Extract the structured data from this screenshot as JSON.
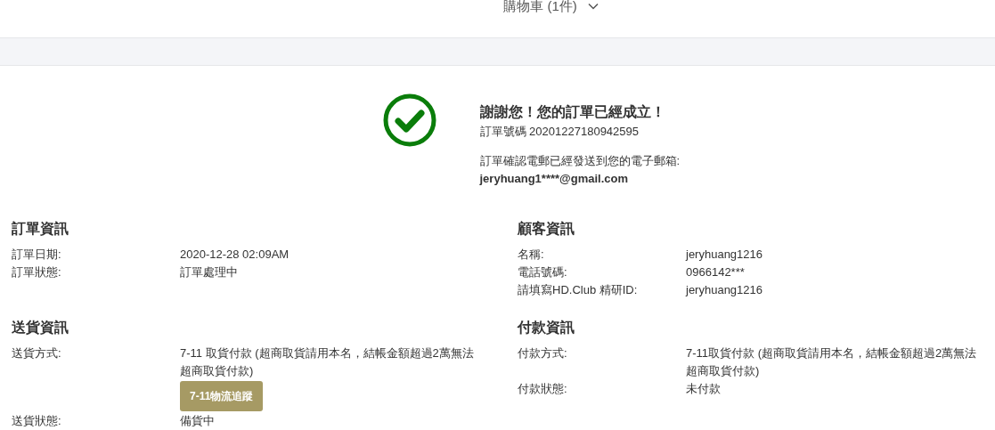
{
  "header": {
    "cart_label": "購物車 (1件)",
    "cart_expanded": false
  },
  "confirmation": {
    "title": "謝謝您！您的訂單已經成立！",
    "order_number": "訂單號碼 20201227180942595",
    "email_note": "訂單確認電郵已經發送到您的電子郵箱:",
    "email": "jeryhuang1****@gmail.com"
  },
  "sections": [
    {
      "title": "訂單資訊",
      "rows": [
        {
          "label": "訂單日期:",
          "value": "2020-12-28 02:09AM"
        },
        {
          "label": "訂單狀態:",
          "value": "訂單處理中"
        }
      ]
    },
    {
      "title": "顧客資訊",
      "rows": [
        {
          "label": "名稱:",
          "value": "jeryhuang1216"
        },
        {
          "label": "電話號碼:",
          "value": "0966142***"
        },
        {
          "label": "請填寫HD.Club 精研ID:",
          "value": "jeryhuang1216"
        }
      ]
    },
    {
      "title": "送貨資訊",
      "rows": [
        {
          "label": "送貨方式:",
          "value": "7-11 取貨付款 (超商取貨請用本名，結帳金額超過2萬無法超商取貨付款)",
          "button": "7-11物流追蹤"
        },
        {
          "label": "送貨狀態:",
          "value": "備貨中"
        }
      ]
    },
    {
      "title": "付款資訊",
      "rows": [
        {
          "label": "付款方式:",
          "value": "7-11取貨付款 (超商取貨請用本名，結帳金額超過2萬無法超商取貨付款)"
        },
        {
          "label": "付款狀態:",
          "value": "未付款"
        }
      ]
    }
  ]
}
